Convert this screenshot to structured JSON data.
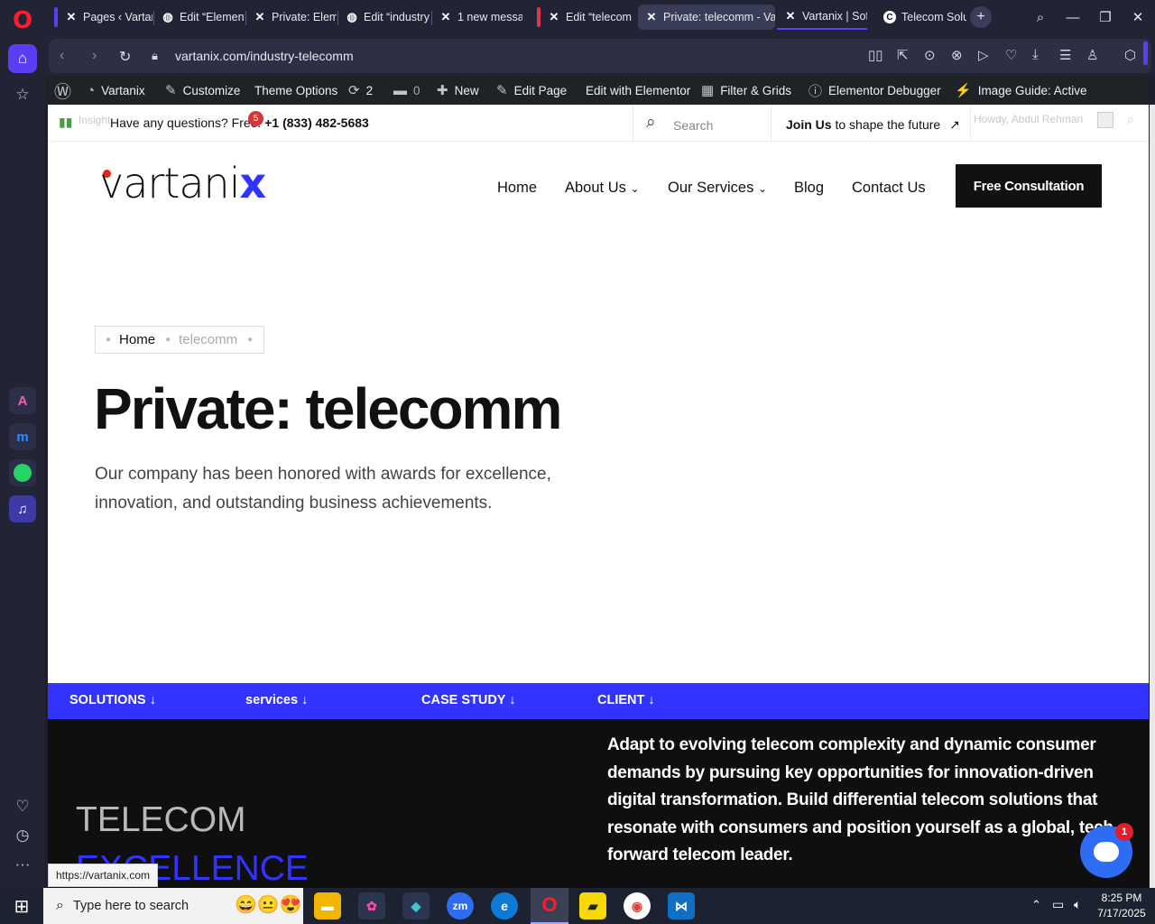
{
  "browser": {
    "tabs": [
      {
        "label": "Pages ‹ Vartan"
      },
      {
        "label": "Edit “Element"
      },
      {
        "label": "Private: Eleme"
      },
      {
        "label": "Edit “industry"
      },
      {
        "label": "1 new messag"
      },
      {
        "label": "Edit “telecom"
      },
      {
        "label": "Private: telecomm - Var"
      },
      {
        "label": "Vartanix | Soft"
      },
      {
        "label": "Telecom Solut"
      }
    ],
    "url": "vartanix.com/industry-telecomm"
  },
  "admin_bar": {
    "site": "Vartanix",
    "customize": "Customize",
    "theme_options": "Theme Options",
    "updates": "2",
    "comments": "0",
    "new": "New",
    "edit_page": "Edit Page",
    "edit_elementor": "Edit with Elementor",
    "filter_grids": "Filter & Grids",
    "debugger": "Elementor Debugger",
    "image_guide": "Image Guide: Active"
  },
  "topbar": {
    "question": "Have any questions? Free:",
    "phone": "+1 (833) 482-5683",
    "notif_count": "5",
    "search_placeholder": "Search",
    "join_bold": "Join Us",
    "join_rest": "to shape the future",
    "howdy": "Howdy, Abdul Rehman",
    "ghost_left": "Insight"
  },
  "header": {
    "logo": "vartanix",
    "nav": {
      "home": "Home",
      "about": "About Us",
      "services": "Our Services",
      "blog": "Blog",
      "contact": "Contact Us"
    },
    "cta": "Free Consultation"
  },
  "hero": {
    "crumb_home": "Home",
    "crumb_current": "telecomm",
    "title": "Private: telecomm",
    "subtitle": "Our company has been honored with awards for excellence, innovation, and outstanding business achievements."
  },
  "categories": [
    "SOLUTIONS",
    "services",
    "CASE STUDY",
    "CLIENT"
  ],
  "dark": {
    "heading_1": "TELECOM",
    "heading_2": "EXCELLENCE",
    "copy": "Adapt to evolving telecom complexity and dynamic consumer demands by pursuing key opportunities for innovation-driven digital transformation. Build differential telecom solutions that resonate with consumers and position yourself as a global, tech-forward telecom leader."
  },
  "status_url": "https://vartanix.com",
  "chat_badge": "1",
  "taskbar": {
    "search_placeholder": "Type here to search",
    "time": "8:25 PM",
    "date": "7/17/2025"
  },
  "colors": {
    "brand_blue": "#3333ff",
    "opera_red": "#ff1b2d",
    "admin_bar": "#1d2327"
  }
}
